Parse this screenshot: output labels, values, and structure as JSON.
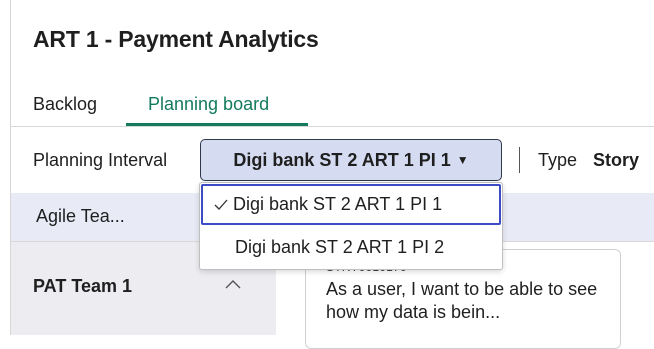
{
  "app": {
    "title": "ART 1 - Payment Analytics"
  },
  "tabs": [
    {
      "label": "Backlog",
      "active": false
    },
    {
      "label": "Planning board",
      "active": true
    }
  ],
  "filters": {
    "planning_interval_label": "Planning Interval",
    "planning_interval_selected": "Digi bank ST 2 ART 1 PI 1",
    "type_label": "Type",
    "type_value": "Story"
  },
  "dropdown": {
    "options": [
      {
        "label": "Digi bank ST 2 ART 1 PI 1",
        "selected": true
      },
      {
        "label": "Digi bank ST 2 ART 1 PI 2",
        "selected": false
      }
    ]
  },
  "board": {
    "column_header": "Agile Tea...",
    "team": {
      "name": "PAT Team 1",
      "expanded": true
    },
    "card": {
      "id": "STRY0010170",
      "text": "As a user, I want to be able to see how my data is bein..."
    }
  },
  "colors": {
    "accent": "#137a5e",
    "select_bg": "#d5dcf1",
    "focus": "#3c4cc4",
    "band": "#e8eaf6"
  }
}
